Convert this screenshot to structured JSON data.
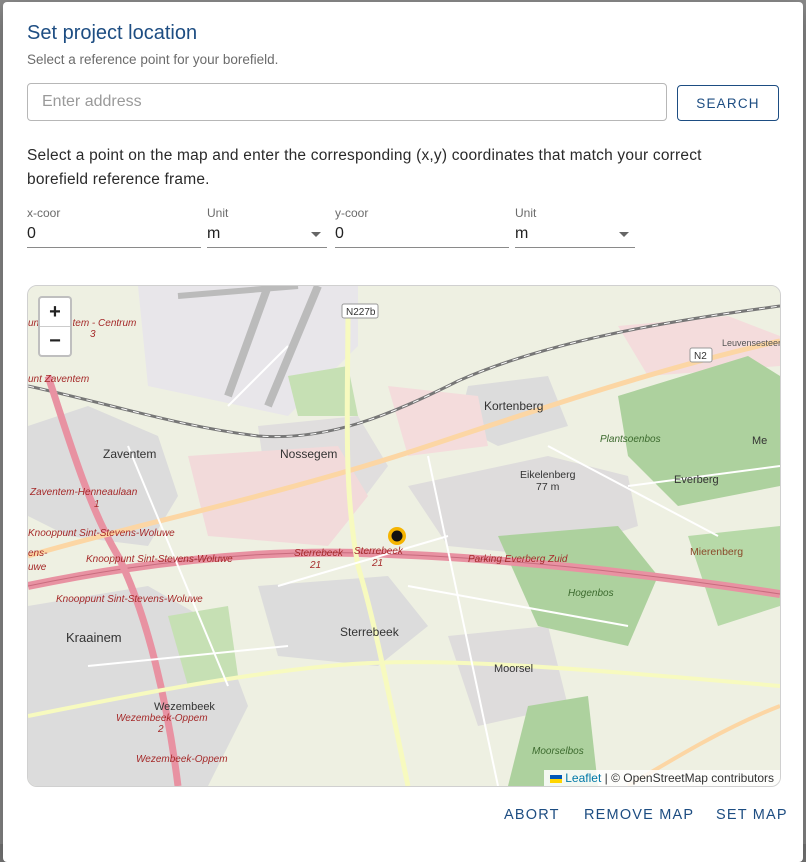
{
  "dialog": {
    "title": "Set project location",
    "subtitle": "Select a reference point for your borefield.",
    "address_placeholder": "Enter address",
    "address_value": "",
    "search_label": "SEARCH",
    "instructions": "Select a point on the map and enter the corresponding (x,y) coordinates that match your correct borefield reference frame."
  },
  "fields": {
    "x_label": "x-coor",
    "x_value": "0",
    "x_unit_label": "Unit",
    "x_unit_value": "m",
    "y_label": "y-coor",
    "y_value": "0",
    "y_unit_label": "Unit",
    "y_unit_value": "m"
  },
  "map": {
    "zoom_in": "+",
    "zoom_out": "−",
    "attribution_link": "Leaflet",
    "attribution_text": "| © OpenStreetMap contributors",
    "labels": {
      "zaventem": "Zaventem",
      "nossegem": "Nossegem",
      "kortenberg": "Kortenberg",
      "eikelenberg": "Eikelenberg",
      "eikelenberg_elev": "77 m",
      "everberg": "Everberg",
      "mierenberg": "Mierenberg",
      "plantsoenbos": "Plantsoenbos",
      "hogenbos": "Hogenbos",
      "sterrebeek": "Sterrebeek",
      "moorsel": "Moorsel",
      "moorselbos": "Moorselbos",
      "kraainem": "Kraainem",
      "wezembeek": "Wezembeek",
      "wezembeek_oppem1": "Wezembeek-Oppem",
      "wezembeek_oppem2": "Wezembeek-Oppem",
      "wezembeek_exit": "2",
      "centrum": "unt Zaventem - Centrum",
      "centrum_exit": "3",
      "zaventem_short": "unt Zaventem",
      "henneaulaan": "Zaventem-Henneaulaan",
      "henneaulaan_exit": "1",
      "knoop1": "Knooppunt Sint-Stevens-Woluwe",
      "knoop2": "Knooppunt Sint-Stevens-Woluwe",
      "knoop3": "Knooppunt Sint-Stevens-Woluwe",
      "stevens_edge": "ens-",
      "stevens_edge2": "uwe",
      "sterrebeek_exit1": "Sterrebeek",
      "sterrebeek_exit2": "Sterrebeek",
      "exit21a": "21",
      "exit21b": "21",
      "parking": "Parking Everberg Zuid",
      "n227b": "N227b",
      "n2": "N2",
      "leuvensesteenweg": "Leuvensesteen",
      "me": "Me"
    }
  },
  "actions": {
    "abort": "ABORT",
    "remove_map": "REMOVE MAP",
    "set_map": "SET MAP"
  }
}
